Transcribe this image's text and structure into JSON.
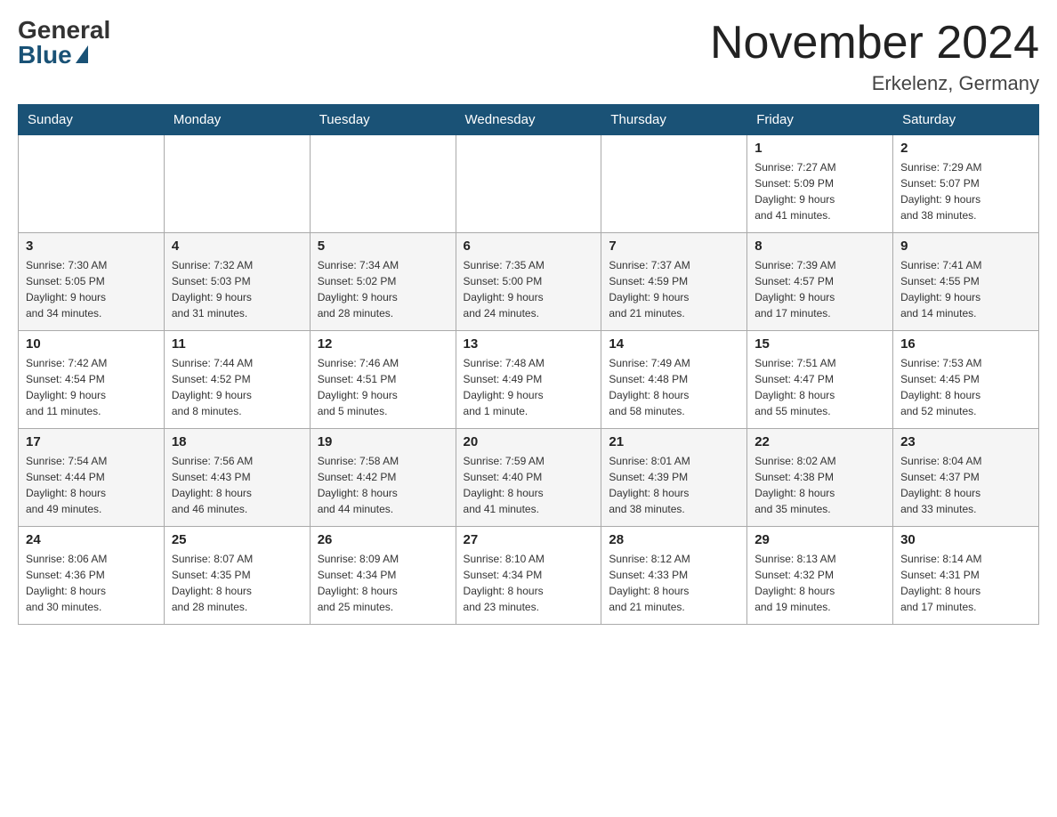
{
  "header": {
    "logo_general": "General",
    "logo_blue": "Blue",
    "month_title": "November 2024",
    "location": "Erkelenz, Germany"
  },
  "days_of_week": [
    "Sunday",
    "Monday",
    "Tuesday",
    "Wednesday",
    "Thursday",
    "Friday",
    "Saturday"
  ],
  "weeks": [
    [
      {
        "day": "",
        "info": ""
      },
      {
        "day": "",
        "info": ""
      },
      {
        "day": "",
        "info": ""
      },
      {
        "day": "",
        "info": ""
      },
      {
        "day": "",
        "info": ""
      },
      {
        "day": "1",
        "info": "Sunrise: 7:27 AM\nSunset: 5:09 PM\nDaylight: 9 hours\nand 41 minutes."
      },
      {
        "day": "2",
        "info": "Sunrise: 7:29 AM\nSunset: 5:07 PM\nDaylight: 9 hours\nand 38 minutes."
      }
    ],
    [
      {
        "day": "3",
        "info": "Sunrise: 7:30 AM\nSunset: 5:05 PM\nDaylight: 9 hours\nand 34 minutes."
      },
      {
        "day": "4",
        "info": "Sunrise: 7:32 AM\nSunset: 5:03 PM\nDaylight: 9 hours\nand 31 minutes."
      },
      {
        "day": "5",
        "info": "Sunrise: 7:34 AM\nSunset: 5:02 PM\nDaylight: 9 hours\nand 28 minutes."
      },
      {
        "day": "6",
        "info": "Sunrise: 7:35 AM\nSunset: 5:00 PM\nDaylight: 9 hours\nand 24 minutes."
      },
      {
        "day": "7",
        "info": "Sunrise: 7:37 AM\nSunset: 4:59 PM\nDaylight: 9 hours\nand 21 minutes."
      },
      {
        "day": "8",
        "info": "Sunrise: 7:39 AM\nSunset: 4:57 PM\nDaylight: 9 hours\nand 17 minutes."
      },
      {
        "day": "9",
        "info": "Sunrise: 7:41 AM\nSunset: 4:55 PM\nDaylight: 9 hours\nand 14 minutes."
      }
    ],
    [
      {
        "day": "10",
        "info": "Sunrise: 7:42 AM\nSunset: 4:54 PM\nDaylight: 9 hours\nand 11 minutes."
      },
      {
        "day": "11",
        "info": "Sunrise: 7:44 AM\nSunset: 4:52 PM\nDaylight: 9 hours\nand 8 minutes."
      },
      {
        "day": "12",
        "info": "Sunrise: 7:46 AM\nSunset: 4:51 PM\nDaylight: 9 hours\nand 5 minutes."
      },
      {
        "day": "13",
        "info": "Sunrise: 7:48 AM\nSunset: 4:49 PM\nDaylight: 9 hours\nand 1 minute."
      },
      {
        "day": "14",
        "info": "Sunrise: 7:49 AM\nSunset: 4:48 PM\nDaylight: 8 hours\nand 58 minutes."
      },
      {
        "day": "15",
        "info": "Sunrise: 7:51 AM\nSunset: 4:47 PM\nDaylight: 8 hours\nand 55 minutes."
      },
      {
        "day": "16",
        "info": "Sunrise: 7:53 AM\nSunset: 4:45 PM\nDaylight: 8 hours\nand 52 minutes."
      }
    ],
    [
      {
        "day": "17",
        "info": "Sunrise: 7:54 AM\nSunset: 4:44 PM\nDaylight: 8 hours\nand 49 minutes."
      },
      {
        "day": "18",
        "info": "Sunrise: 7:56 AM\nSunset: 4:43 PM\nDaylight: 8 hours\nand 46 minutes."
      },
      {
        "day": "19",
        "info": "Sunrise: 7:58 AM\nSunset: 4:42 PM\nDaylight: 8 hours\nand 44 minutes."
      },
      {
        "day": "20",
        "info": "Sunrise: 7:59 AM\nSunset: 4:40 PM\nDaylight: 8 hours\nand 41 minutes."
      },
      {
        "day": "21",
        "info": "Sunrise: 8:01 AM\nSunset: 4:39 PM\nDaylight: 8 hours\nand 38 minutes."
      },
      {
        "day": "22",
        "info": "Sunrise: 8:02 AM\nSunset: 4:38 PM\nDaylight: 8 hours\nand 35 minutes."
      },
      {
        "day": "23",
        "info": "Sunrise: 8:04 AM\nSunset: 4:37 PM\nDaylight: 8 hours\nand 33 minutes."
      }
    ],
    [
      {
        "day": "24",
        "info": "Sunrise: 8:06 AM\nSunset: 4:36 PM\nDaylight: 8 hours\nand 30 minutes."
      },
      {
        "day": "25",
        "info": "Sunrise: 8:07 AM\nSunset: 4:35 PM\nDaylight: 8 hours\nand 28 minutes."
      },
      {
        "day": "26",
        "info": "Sunrise: 8:09 AM\nSunset: 4:34 PM\nDaylight: 8 hours\nand 25 minutes."
      },
      {
        "day": "27",
        "info": "Sunrise: 8:10 AM\nSunset: 4:34 PM\nDaylight: 8 hours\nand 23 minutes."
      },
      {
        "day": "28",
        "info": "Sunrise: 8:12 AM\nSunset: 4:33 PM\nDaylight: 8 hours\nand 21 minutes."
      },
      {
        "day": "29",
        "info": "Sunrise: 8:13 AM\nSunset: 4:32 PM\nDaylight: 8 hours\nand 19 minutes."
      },
      {
        "day": "30",
        "info": "Sunrise: 8:14 AM\nSunset: 4:31 PM\nDaylight: 8 hours\nand 17 minutes."
      }
    ]
  ]
}
